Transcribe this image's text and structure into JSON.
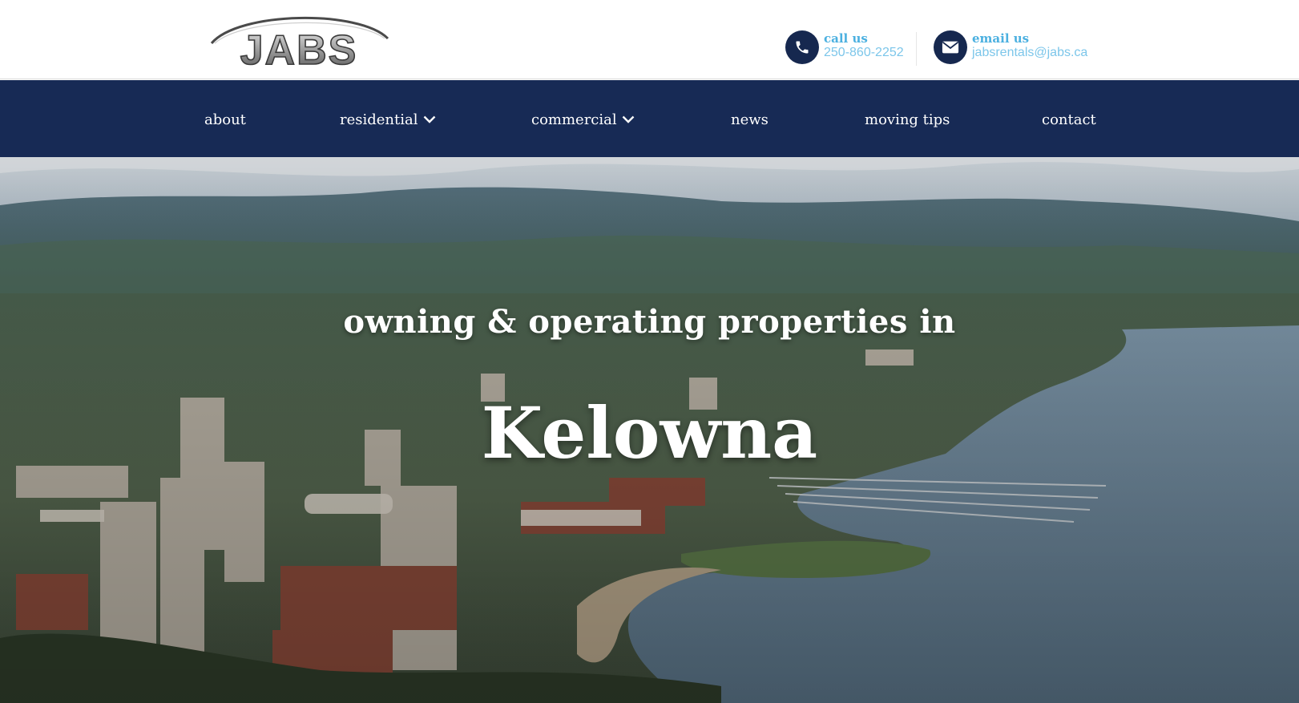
{
  "brand": {
    "logo_text": "JABS"
  },
  "header": {
    "phone": {
      "label": "call us",
      "value": "250-860-2252",
      "icon": "phone-icon"
    },
    "email": {
      "label": "email us",
      "value": "jabsrentals@jabs.ca",
      "icon": "envelope-icon"
    }
  },
  "nav": {
    "items": [
      {
        "label": "about",
        "has_dropdown": false
      },
      {
        "label": "residential",
        "has_dropdown": true
      },
      {
        "label": "commercial",
        "has_dropdown": true
      },
      {
        "label": "news",
        "has_dropdown": false
      },
      {
        "label": "moving tips",
        "has_dropdown": false
      },
      {
        "label": "contact",
        "has_dropdown": false
      }
    ]
  },
  "hero": {
    "subtitle": "owning & operating properties in",
    "title": "Kelowna"
  },
  "colors": {
    "navy": "#172a55",
    "accent_blue": "#4bb0e0",
    "white": "#ffffff"
  }
}
